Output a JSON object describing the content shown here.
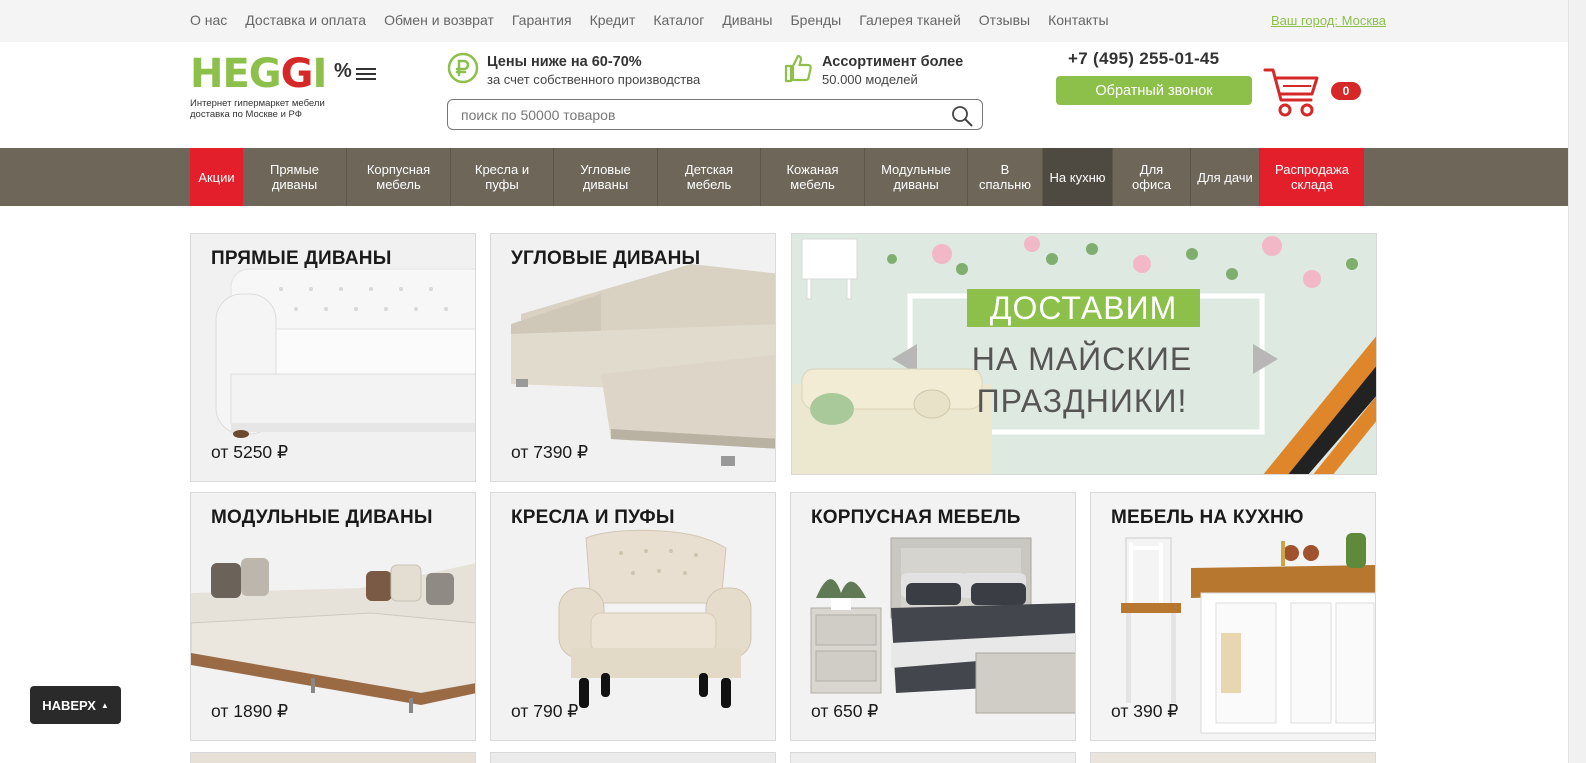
{
  "top_nav": {
    "links": [
      "О нас",
      "Доставка и оплата",
      "Обмен и возврат",
      "Гарантия",
      "Кредит",
      "Каталог",
      "Диваны",
      "Бренды",
      "Галерея тканей",
      "Отзывы",
      "Контакты"
    ],
    "city": "Ваш город: Москва"
  },
  "header": {
    "logo": {
      "text": "HEGGI",
      "percent": "%",
      "tagline_1": "Интернет гипермаркет мебели",
      "tagline_2": "доставка по Москве и РФ"
    },
    "feature_price": {
      "title": "Цены ниже на 60-70%",
      "subtitle": "за счет собственного производства",
      "icon": "ruble-circle-icon"
    },
    "feature_assortment": {
      "title": "Ассортимент более",
      "subtitle": "50.000 моделей",
      "icon": "thumbs-up-icon"
    },
    "search": {
      "placeholder": "поиск по 50000 товаров",
      "value": ""
    },
    "phone": "+7 (495) 255-01-45",
    "callback_label": "Обратный звонок",
    "cart_count": "0",
    "accent_green": "#8cc04b",
    "accent_red": "#d72828"
  },
  "main_nav": {
    "items": [
      {
        "label": "Акции",
        "style": "red"
      },
      {
        "label": "Прямые диваны",
        "style": ""
      },
      {
        "label": "Корпусная мебель",
        "style": ""
      },
      {
        "label": "Кресла и пуфы",
        "style": ""
      },
      {
        "label": "Угловые диваны",
        "style": ""
      },
      {
        "label": "Детская мебель",
        "style": ""
      },
      {
        "label": "Кожаная мебель",
        "style": ""
      },
      {
        "label": "Модульные диваны",
        "style": ""
      },
      {
        "label": "В спальню",
        "style": ""
      },
      {
        "label": "На кухню",
        "style": "active"
      },
      {
        "label": "Для офиса",
        "style": ""
      },
      {
        "label": "Для дачи",
        "style": ""
      },
      {
        "label": "Распродажа склада",
        "style": "red"
      }
    ]
  },
  "categories": [
    {
      "title": "ПРЯМЫЕ ДИВАНЫ",
      "price": "от 5250 ₽",
      "image": "white-chesterfield-sofa"
    },
    {
      "title": "УГЛОВЫЕ ДИВАНЫ",
      "price": "от 7390 ₽",
      "image": "beige-corner-sofa"
    },
    {
      "title": "МОДУЛЬНЫЕ ДИВАНЫ",
      "price": "от 1890 ₽",
      "image": "modular-sofa"
    },
    {
      "title": "КРЕСЛА И ПУФЫ",
      "price": "от 790 ₽",
      "image": "tufted-armchair"
    },
    {
      "title": "КОРПУСНАЯ МЕБЕЛЬ",
      "price": "от 650 ₽",
      "image": "bed-with-nightstand"
    },
    {
      "title": "МЕБЕЛЬ НА КУХНЮ",
      "price": "от 390 ₽",
      "image": "kitchen-island"
    }
  ],
  "banner": {
    "line_1": "ДОСТАВИМ",
    "line_2": "НА МАЙСКИЕ",
    "line_3": "ПРАЗДНИКИ!"
  },
  "back_to_top": {
    "label": "НАВЕРХ",
    "arrow": "▲"
  }
}
